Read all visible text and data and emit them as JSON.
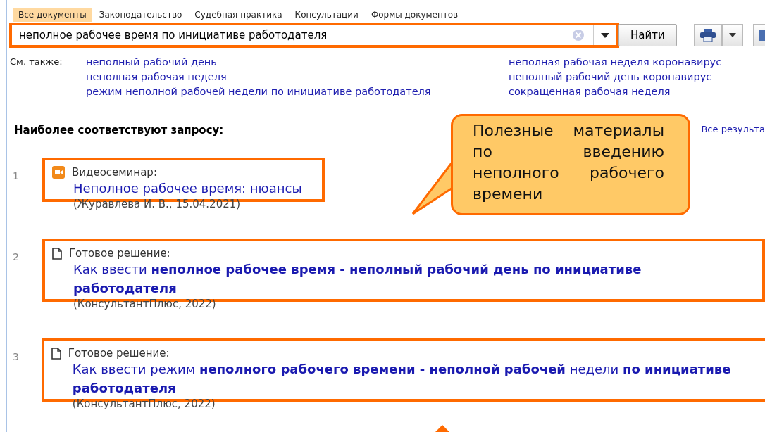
{
  "tabs": [
    {
      "label": "Все документы",
      "selected": true
    },
    {
      "label": "Законодательство",
      "selected": false
    },
    {
      "label": "Судебная практика",
      "selected": false
    },
    {
      "label": "Консультации",
      "selected": false
    },
    {
      "label": "Формы документов",
      "selected": false
    }
  ],
  "search": {
    "value": "неполное рабочее время по инициативе работодателя",
    "highlighted": true,
    "button": "Найти"
  },
  "see_also": {
    "label": "См. также:",
    "links": [
      "неполный рабочий день",
      "неполная рабочая неделя",
      "режим неполной рабочей недели по инициативе работодателя",
      "неполная рабочая неделя коронавирус",
      "неполный рабочий день коронавирус",
      "сокращенная рабочая неделя"
    ]
  },
  "heading": "Наиболее соответствуют запросу:",
  "all_results": "Все результа",
  "callout": "Полезные материалы по введению неполного рабочего времени",
  "results": [
    {
      "number": "1",
      "kind": "video",
      "type": "Видеосеминар:",
      "title": "Неполное рабочее время: нюансы",
      "source": "(Журавлева И. В., 15.04.2021)",
      "highlighted": true
    },
    {
      "number": "2",
      "kind": "document",
      "type": "Готовое решение:",
      "title": "Как ввести **неполное рабочее время - неполный рабочий день по инициативе работодателя**",
      "source": "(КонсультантПлюс, 2022)",
      "highlighted": true
    },
    {
      "number": "3",
      "kind": "document",
      "type": "Готовое решение:",
      "title": "Как ввести режим **неполного рабочего времени - неполной рабочей** недели **по инициативе работодателя**",
      "source": "(КонсультантПлюс, 2022)",
      "highlighted": true
    }
  ]
}
